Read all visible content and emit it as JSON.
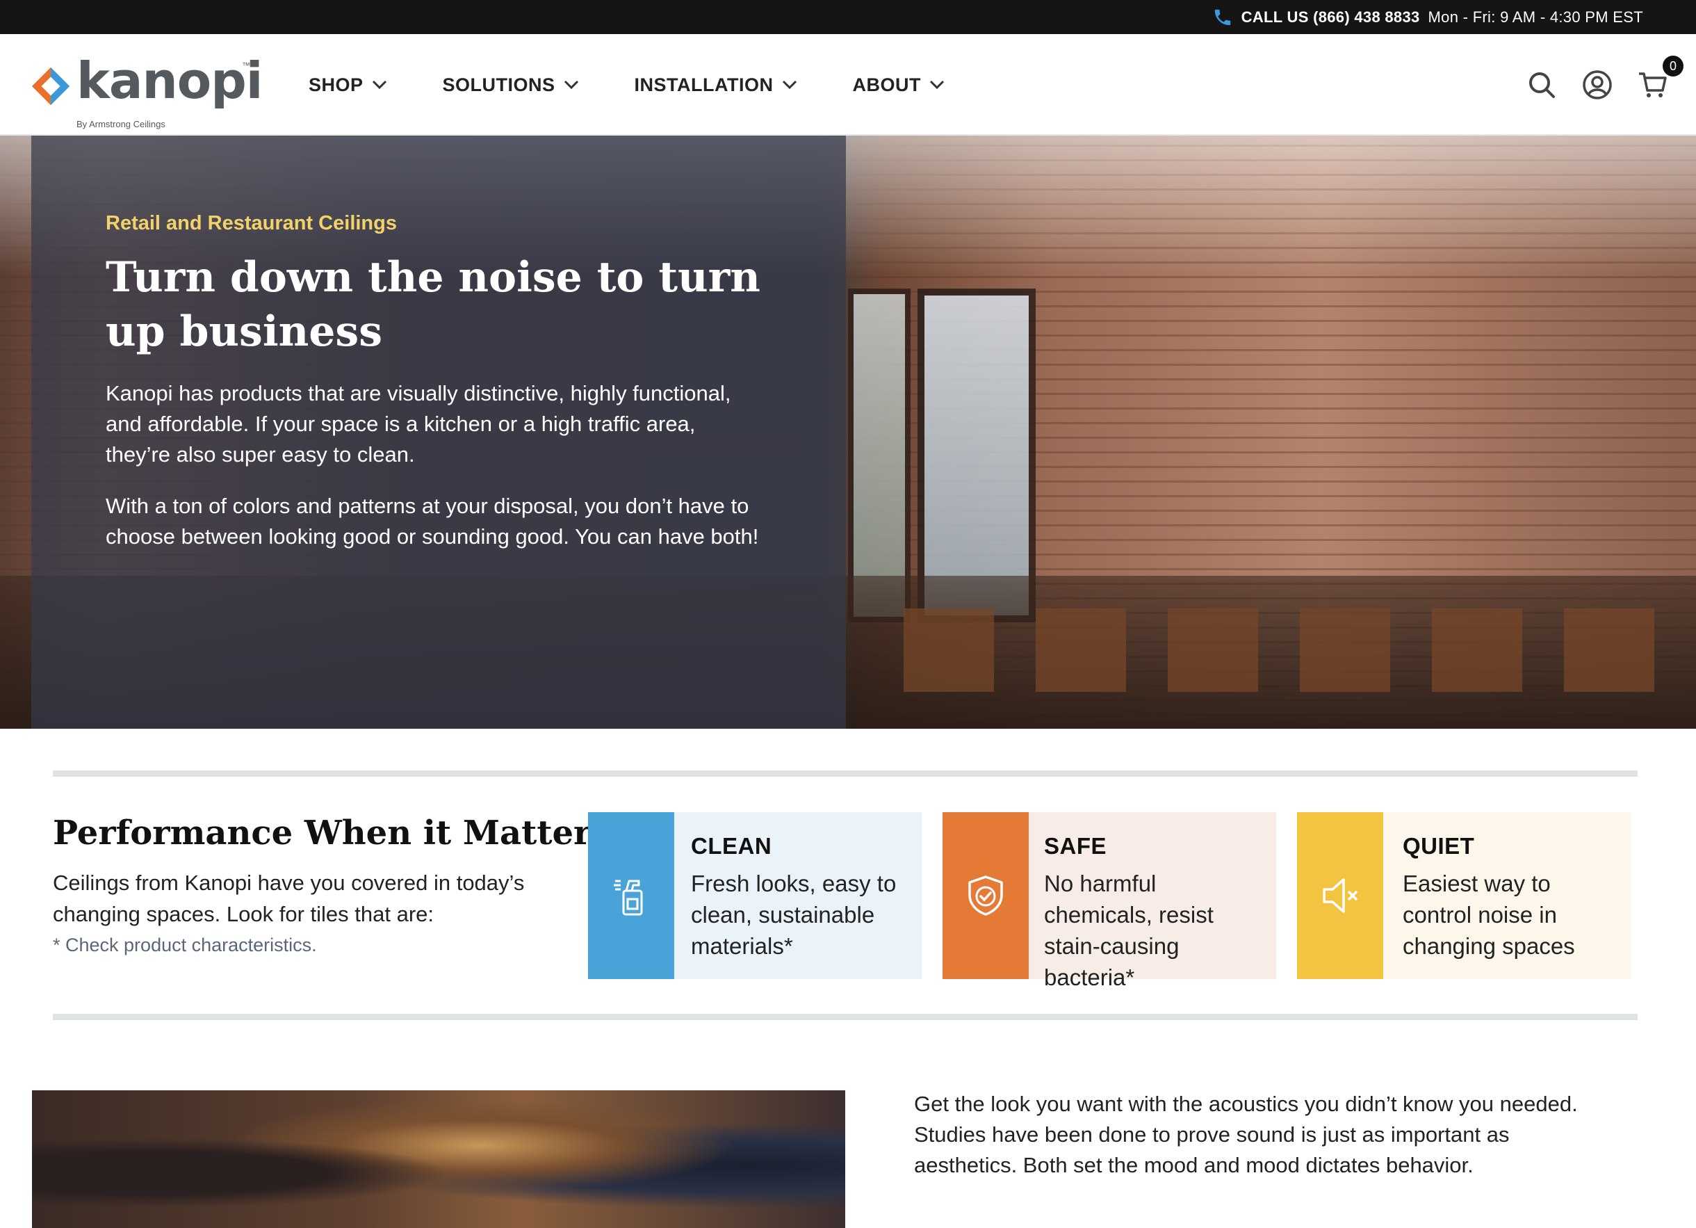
{
  "topbar": {
    "call_label": "CALL US (866) 438 8833",
    "hours": "Mon - Fri: 9 AM - 4:30 PM EST"
  },
  "header": {
    "logo_word": "kanopi",
    "logo_tm": "™",
    "logo_sub": "By Armstrong Ceilings",
    "nav": [
      {
        "label": "SHOP"
      },
      {
        "label": "SOLUTIONS"
      },
      {
        "label": "INSTALLATION"
      },
      {
        "label": "ABOUT"
      }
    ],
    "icons": [
      "search-icon",
      "account-icon",
      "cart-icon"
    ],
    "cart_count": "0"
  },
  "hero": {
    "eyebrow": "Retail and Restaurant Ceilings",
    "title": "Turn down the noise to turn up business",
    "paragraph1": "Kanopi has products that are visually distinctive, highly functional, and affordable. If your space is a kitchen or a high traffic area, they’re also super easy to clean.",
    "paragraph2": "With a ton of colors and patterns at your disposal, you don’t have to choose between looking good or sounding good. You can have both!"
  },
  "performance": {
    "title": "Performance When it Matters",
    "description": "Ceilings from Kanopi have you covered in today’s changing spaces. Look for tiles that are:",
    "note": "* Check product characteristics.",
    "cards": [
      {
        "title": "CLEAN",
        "desc": "Fresh looks, easy to clean, sustainable materials*",
        "icon": "spray-bottle-icon",
        "color": "#4aa3d8"
      },
      {
        "title": "SAFE",
        "desc": "No harmful chemicals, resist stain-causing bacteria*",
        "icon": "shield-check-icon",
        "color": "#e47a36"
      },
      {
        "title": "QUIET",
        "desc": "Easiest way to control noise in changing spaces",
        "icon": "speaker-mute-icon",
        "color": "#f2c43f"
      }
    ]
  },
  "bottom": {
    "text": "Get the look you want with the acoustics you didn’t know you needed. Studies have been done to prove sound is just as important as aesthetics. Both set the mood and mood dictates behavior."
  },
  "colors": {
    "topbar_bg": "#151515",
    "eyebrow": "#f3d26a",
    "hero_overlay": "#343a4c",
    "clean": "#4aa3d8",
    "safe": "#e47a36",
    "quiet": "#f2c43f",
    "logo_orange": "#e8702a",
    "logo_blue": "#3a9ad9"
  }
}
